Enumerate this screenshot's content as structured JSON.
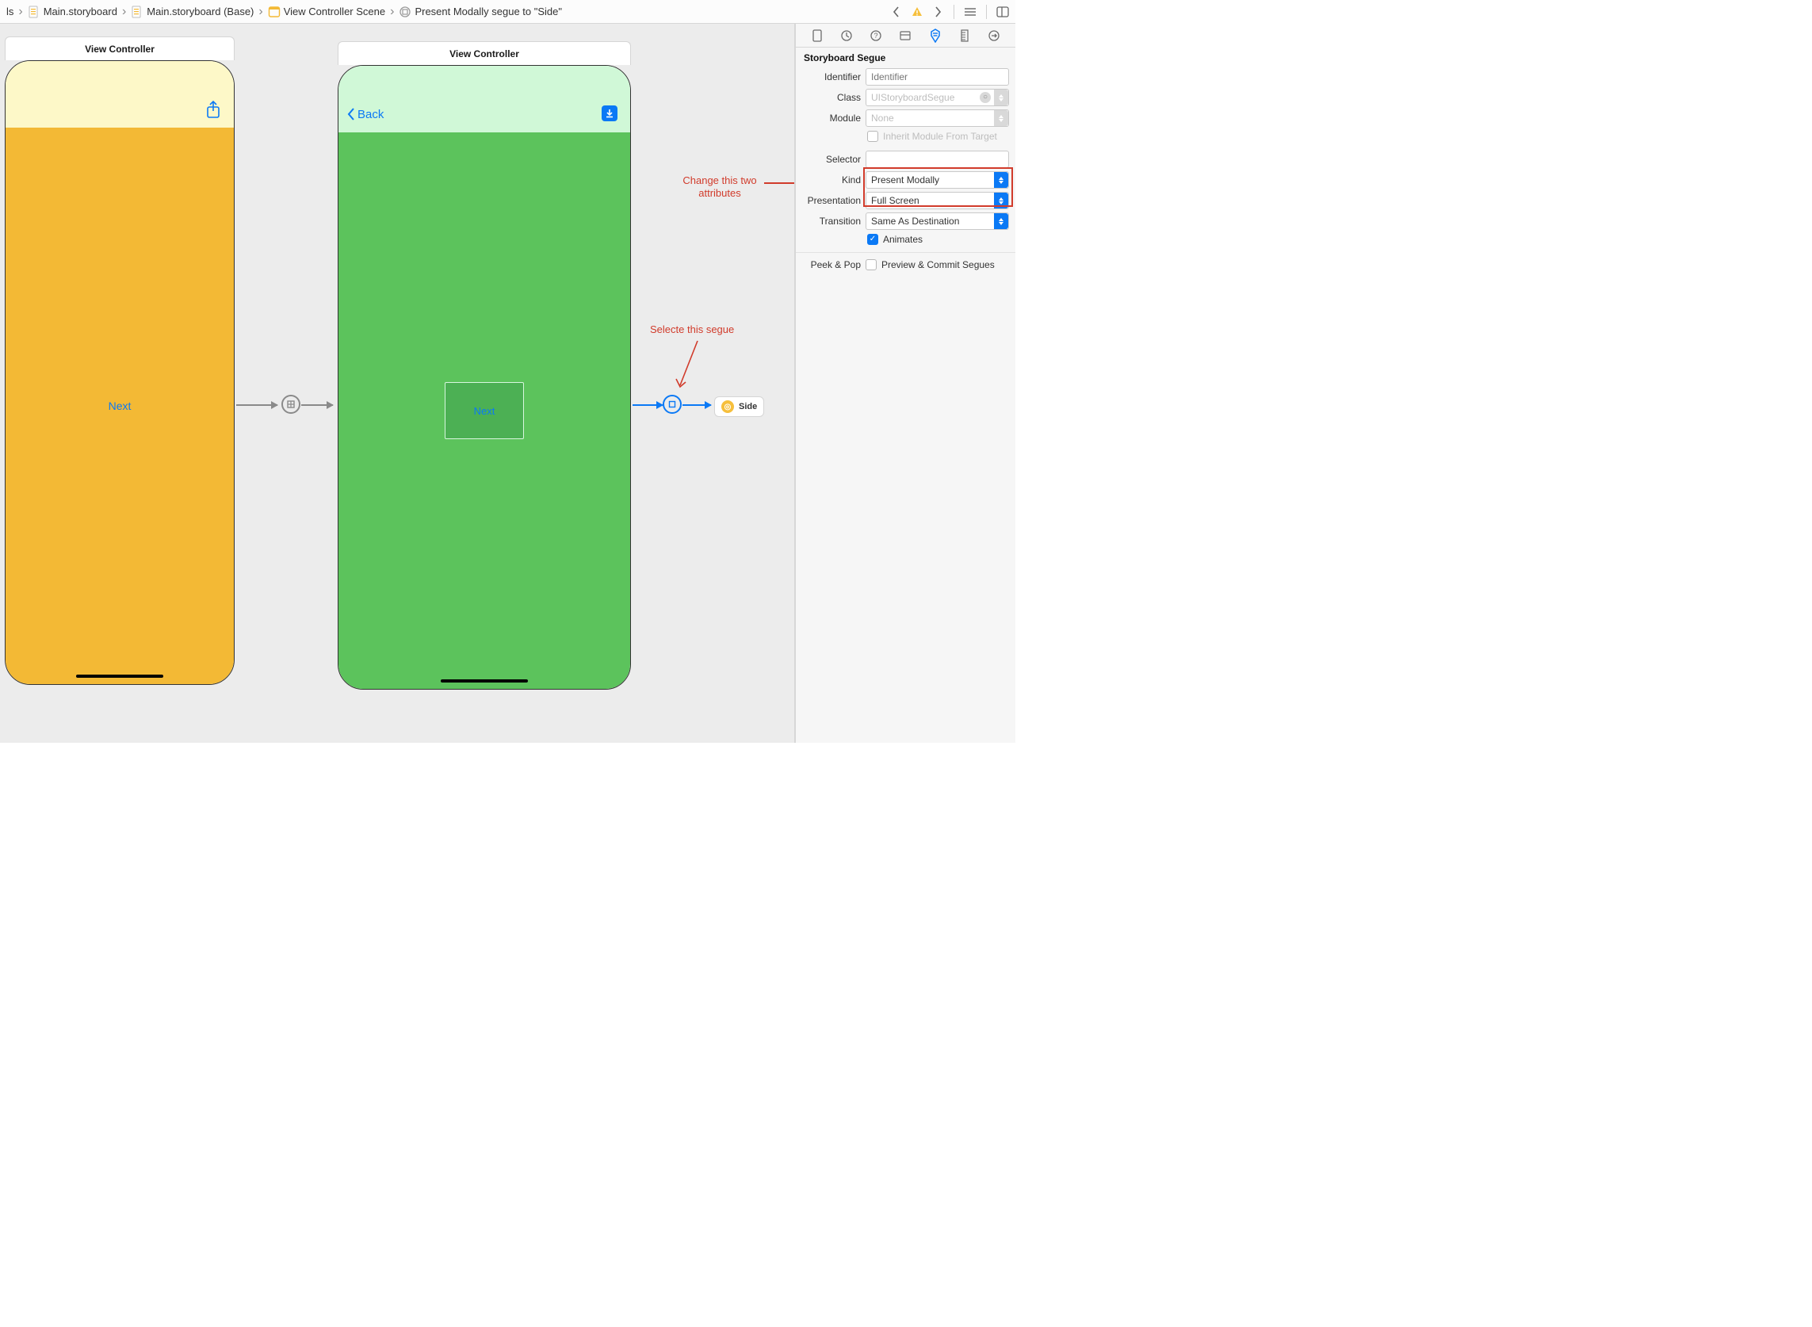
{
  "breadcrumb": {
    "items": [
      {
        "label": "ls"
      },
      {
        "label": "Main.storyboard"
      },
      {
        "label": "Main.storyboard (Base)"
      },
      {
        "label": "View Controller Scene"
      },
      {
        "label": "Present Modally segue to \"Side\""
      }
    ]
  },
  "canvas": {
    "vc1": {
      "title": "View Controller",
      "next_label": "Next"
    },
    "vc2": {
      "title": "View Controller",
      "back_label": "Back",
      "next_label": "Next"
    },
    "side_badge": "Side"
  },
  "annotations": {
    "change_attrs": "Change this two attributes",
    "select_segue": "Selecte this segue"
  },
  "inspector": {
    "section_title": "Storyboard Segue",
    "identifier": {
      "label": "Identifier",
      "placeholder": "Identifier",
      "value": ""
    },
    "class": {
      "label": "Class",
      "value": "UIStoryboardSegue"
    },
    "module": {
      "label": "Module",
      "value": "None"
    },
    "inherit": {
      "label": "Inherit Module From Target",
      "checked": false
    },
    "selector": {
      "label": "Selector",
      "value": ""
    },
    "kind": {
      "label": "Kind",
      "value": "Present Modally"
    },
    "presentation": {
      "label": "Presentation",
      "value": "Full Screen"
    },
    "transition": {
      "label": "Transition",
      "value": "Same As Destination"
    },
    "animates": {
      "label": "Animates",
      "checked": true
    },
    "peek_pop": {
      "label": "Peek & Pop",
      "option": "Preview & Commit Segues",
      "checked": false
    }
  }
}
